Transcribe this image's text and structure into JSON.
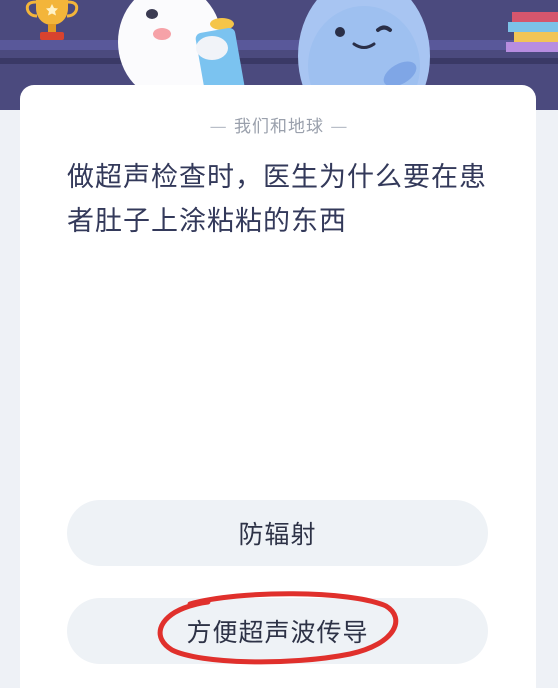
{
  "header": {
    "icons": [
      "trophy-icon",
      "chick-mascot",
      "seal-mascot",
      "books-icon"
    ]
  },
  "card": {
    "category_title": "我们和地球",
    "question": "做超声检查时，医生为什么要在患者肚子上涂粘粘的东西",
    "options": [
      {
        "label": "防辐射"
      },
      {
        "label": "方便超声波传导"
      }
    ],
    "annotation_color": "#e0302c"
  }
}
